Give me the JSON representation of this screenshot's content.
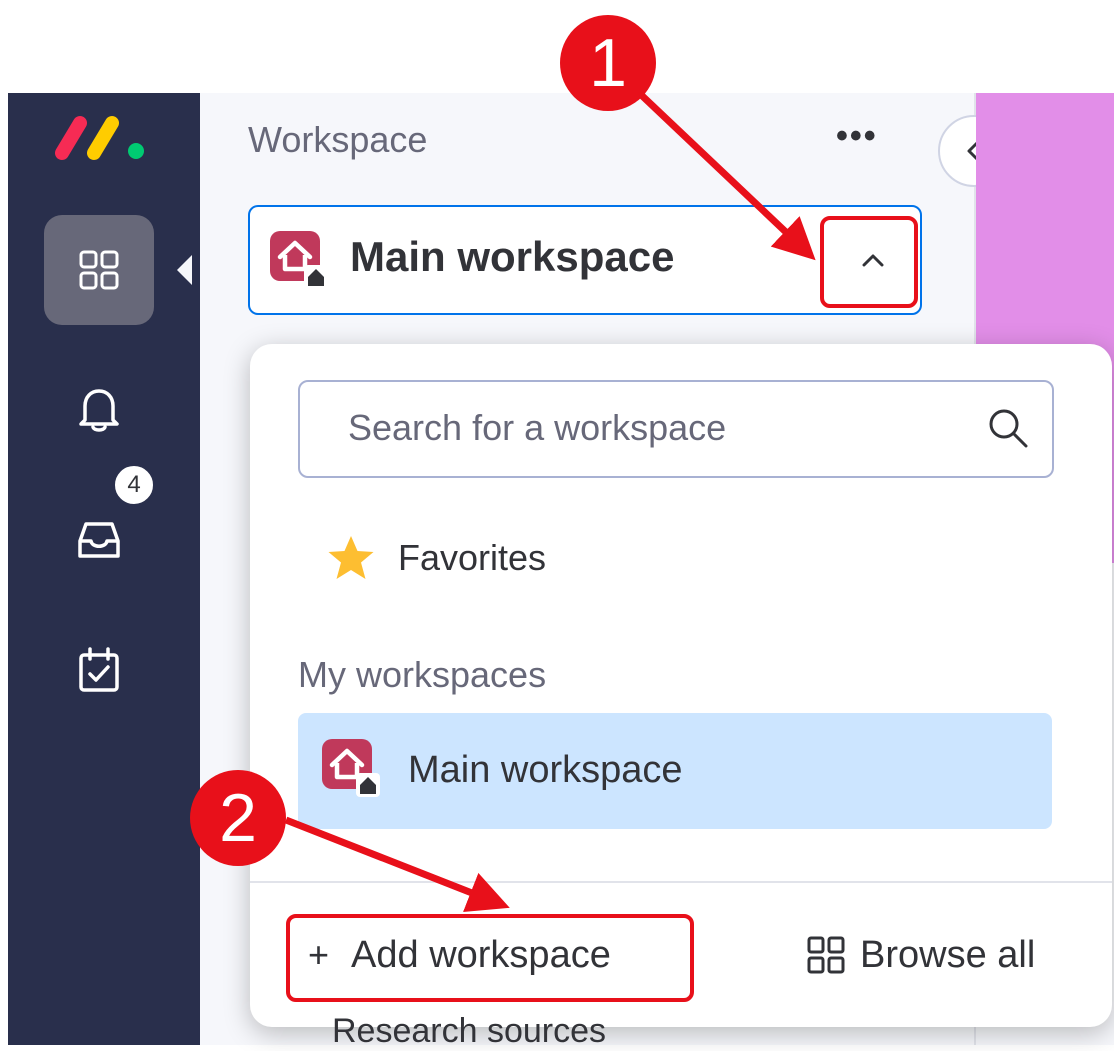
{
  "rail": {
    "inbox_badge": "4"
  },
  "panel": {
    "title": "Workspace",
    "more_label": "•••"
  },
  "selector": {
    "workspace_name": "Main workspace",
    "expanded": true
  },
  "dropdown": {
    "search_placeholder": "Search for a workspace",
    "search_value": "",
    "favorites_label": "Favorites",
    "section_label": "My workspaces",
    "workspaces": [
      {
        "label": "Main workspace",
        "selected": true
      }
    ],
    "add_label": "Add workspace",
    "add_icon": "+",
    "browse_label": "Browse all"
  },
  "peek_row_text": "Research sources",
  "annotations": {
    "step1": "1",
    "step2": "2",
    "color": "#e8101a"
  },
  "colors": {
    "rail_bg": "#292f4c",
    "panel_bg": "#f6f7fb",
    "accent": "#0073ea",
    "selected_bg": "#cce5ff",
    "avatar": "#c0395b",
    "purple_strip": "#e28ee8",
    "star": "#fdbe31"
  },
  "icons": [
    "monday-logo",
    "workspaces-icon",
    "bell-icon",
    "inbox-icon",
    "calendar-check-icon",
    "chevron-left-icon",
    "chevron-up-icon",
    "search-icon",
    "star-icon",
    "home-icon",
    "grid-icon"
  ]
}
